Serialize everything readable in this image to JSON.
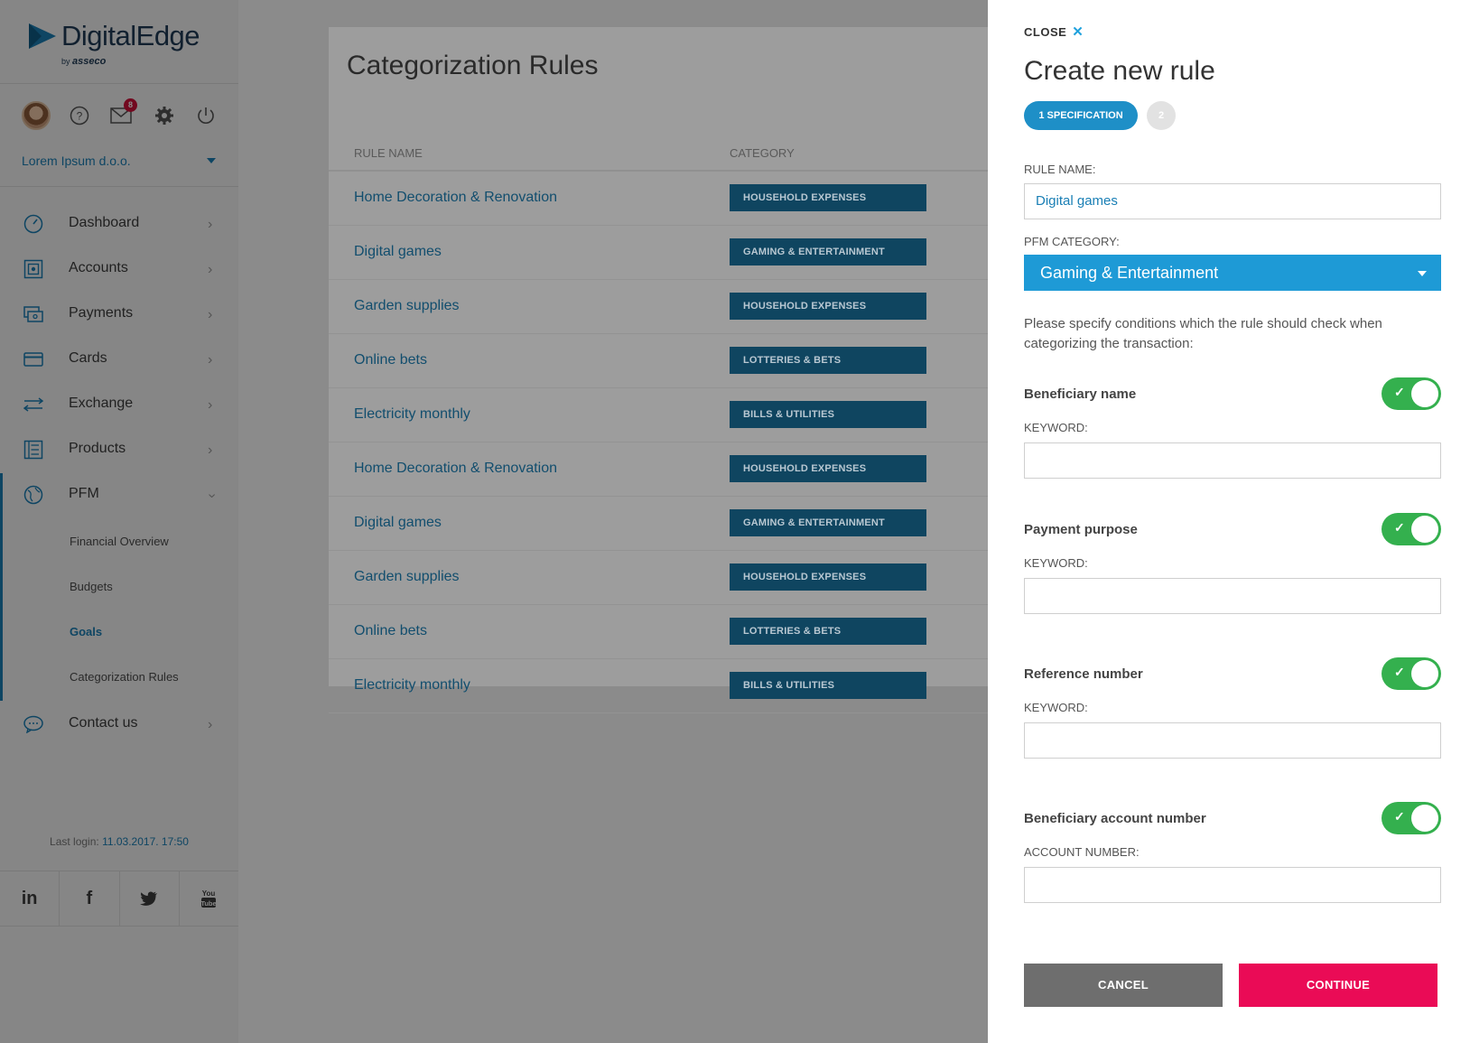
{
  "brand": {
    "name": "DigitalEdge",
    "byline": "by",
    "company": "asseco"
  },
  "header": {
    "notifications_count": "8",
    "company_name": "Lorem Ipsum d.o.o."
  },
  "sidebar": {
    "items": [
      {
        "label": "Dashboard"
      },
      {
        "label": "Accounts"
      },
      {
        "label": "Payments"
      },
      {
        "label": "Cards"
      },
      {
        "label": "Exchange"
      },
      {
        "label": "Products"
      },
      {
        "label": "PFM"
      },
      {
        "label": "Contact us"
      }
    ],
    "pfm_sub": [
      {
        "label": "Financial Overview"
      },
      {
        "label": "Budgets"
      },
      {
        "label": "Goals"
      },
      {
        "label": "Categorization Rules"
      }
    ],
    "last_login_label": "Last login:",
    "last_login_value": "11.03.2017. 17:50",
    "social": [
      "in",
      "f",
      "twitter",
      "YouTube"
    ]
  },
  "main": {
    "title": "Categorization Rules",
    "columns": [
      "RULE NAME",
      "CATEGORY"
    ],
    "rows": [
      {
        "name": "Home Decoration & Renovation",
        "category": "HOUSEHOLD EXPENSES"
      },
      {
        "name": "Digital games",
        "category": "GAMING & ENTERTAINMENT"
      },
      {
        "name": "Garden supplies",
        "category": "HOUSEHOLD EXPENSES"
      },
      {
        "name": "Online bets",
        "category": "LOTTERIES & BETS"
      },
      {
        "name": "Electricity monthly",
        "category": "BILLS & UTILITIES"
      },
      {
        "name": "Home Decoration & Renovation",
        "category": "HOUSEHOLD EXPENSES"
      },
      {
        "name": "Digital games",
        "category": "GAMING & ENTERTAINMENT"
      },
      {
        "name": "Garden supplies",
        "category": "HOUSEHOLD EXPENSES"
      },
      {
        "name": "Online bets",
        "category": "LOTTERIES & BETS"
      },
      {
        "name": "Electricity monthly",
        "category": "BILLS & UTILITIES"
      }
    ]
  },
  "panel": {
    "close_label": "CLOSE",
    "title": "Create new rule",
    "step1": "1 SPECIFICATION",
    "step2": "2",
    "rule_name_label": "RULE NAME:",
    "rule_name_value": "Digital games",
    "category_label": "PFM CATEGORY:",
    "category_value": "Gaming & Entertainment",
    "helper_text": "Please specify conditions which the rule should check when categorizing the transaction:",
    "conditions": [
      {
        "label": "Beneficiary name",
        "field_label": "KEYWORD:",
        "enabled": true,
        "value": ""
      },
      {
        "label": "Payment purpose",
        "field_label": "KEYWORD:",
        "enabled": true,
        "value": ""
      },
      {
        "label": "Reference number",
        "field_label": "KEYWORD:",
        "enabled": true,
        "value": ""
      },
      {
        "label": "Beneficiary account number",
        "field_label": "ACCOUNT NUMBER:",
        "enabled": true,
        "value": ""
      }
    ],
    "cancel_label": "CANCEL",
    "continue_label": "CONTINUE"
  },
  "colors": {
    "accent": "#1e9ad6",
    "toggle_on": "#34b04e",
    "continue": "#ea0b56",
    "cancel": "#6e6e6e",
    "category_badge": "#0f4560"
  }
}
